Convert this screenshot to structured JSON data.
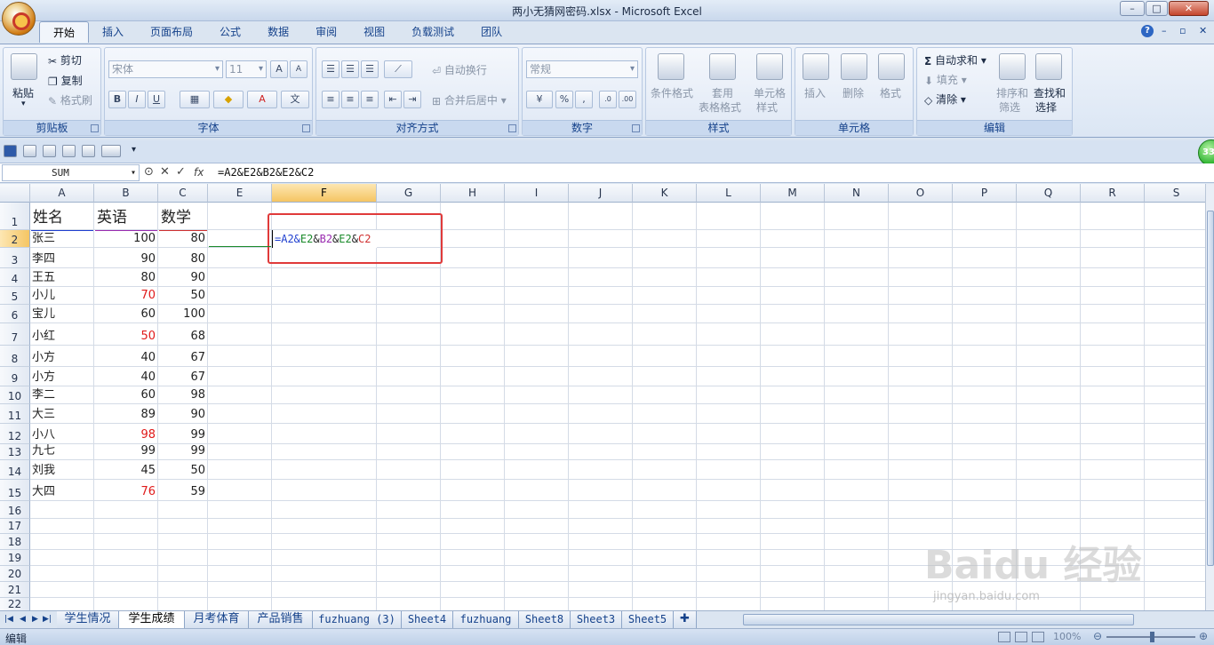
{
  "window": {
    "title": "两小无猜网密码.xlsx - Microsoft Excel",
    "min": "–",
    "max": "□",
    "close": "✕"
  },
  "tabs": [
    "开始",
    "插入",
    "页面布局",
    "公式",
    "数据",
    "审阅",
    "视图",
    "负载测试",
    "团队"
  ],
  "ribbon": {
    "clipboard": {
      "label": "剪贴板",
      "paste": "粘贴",
      "cut": "剪切",
      "copy": "复制",
      "format_painter": "格式刷"
    },
    "font": {
      "label": "字体",
      "font_name": "宋体",
      "font_size": "11",
      "bold": "B",
      "italic": "I",
      "underline": "U",
      "grow": "A",
      "shrink": "A"
    },
    "alignment": {
      "label": "对齐方式",
      "wrap": "自动换行",
      "merge": "合并后居中"
    },
    "number": {
      "label": "数字",
      "format": "常规",
      "percent": "%",
      "comma": ","
    },
    "styles": {
      "label": "样式",
      "conditional": "条件格式",
      "table_format_1": "套用",
      "table_format_2": "表格格式",
      "cell_style_1": "单元格",
      "cell_style_2": "样式"
    },
    "cells": {
      "label": "单元格",
      "insert": "插入",
      "delete": "删除",
      "format": "格式"
    },
    "editing": {
      "label": "编辑",
      "autosum": "自动求和",
      "fill": "填充",
      "clear": "清除",
      "sort_1": "排序和",
      "sort_2": "筛选",
      "find_1": "查找和",
      "find_2": "选择"
    }
  },
  "formula_bar": {
    "name_box": "SUM",
    "formula": "=A2&E2&B2&E2&C2",
    "fx": "fx"
  },
  "columns": [
    "A",
    "B",
    "C",
    "E",
    "F",
    "G",
    "H",
    "I",
    "J",
    "K",
    "L",
    "M",
    "N",
    "O",
    "P",
    "Q",
    "R",
    "S"
  ],
  "rows": [
    "1",
    "2",
    "3",
    "4",
    "5",
    "6",
    "7",
    "8",
    "9",
    "10",
    "11",
    "12",
    "13",
    "14",
    "15",
    "16",
    "17",
    "18",
    "19",
    "20",
    "21",
    "22"
  ],
  "headers": {
    "name": "姓名",
    "english": "英语",
    "math": "数学"
  },
  "students": [
    {
      "name": "张三",
      "english": "100",
      "math": "80",
      "red": false
    },
    {
      "name": "李四",
      "english": "90",
      "math": "80",
      "red": false
    },
    {
      "name": "王五",
      "english": "80",
      "math": "90",
      "red": false
    },
    {
      "name": "小儿",
      "english": "70",
      "math": "50",
      "red": true
    },
    {
      "name": "宝儿",
      "english": "60",
      "math": "100",
      "red": false
    },
    {
      "name": "小红",
      "english": "50",
      "math": "68",
      "red": true
    },
    {
      "name": "小方",
      "english": "40",
      "math": "67",
      "red": false
    },
    {
      "name": "小方",
      "english": "40",
      "math": "67",
      "red": false
    },
    {
      "name": "李二",
      "english": "60",
      "math": "98",
      "red": false
    },
    {
      "name": "大三",
      "english": "89",
      "math": "90",
      "red": false
    },
    {
      "name": "小八",
      "english": "98",
      "math": "99",
      "red": true
    },
    {
      "name": "九七",
      "english": "99",
      "math": "99",
      "red": false
    },
    {
      "name": "刘我",
      "english": "45",
      "math": "50",
      "red": false
    },
    {
      "name": "大四",
      "english": "76",
      "math": "59",
      "red": true
    }
  ],
  "edit_cell": {
    "p1": "=A2&",
    "p2": "E2",
    "p3": "&",
    "p4": "B2",
    "p5": "&",
    "p6": "E2",
    "p7": "&",
    "p8": "C2"
  },
  "sheets": [
    "学生情况",
    "学生成绩",
    "月考体育",
    "产品销售",
    "fuzhuang (3)",
    "Sheet4",
    "fuzhuang",
    "Sheet8",
    "Sheet3",
    "Sheet5"
  ],
  "active_sheet": "学生成绩",
  "status": {
    "mode": "编辑",
    "zoom": "100%"
  },
  "badge": "33",
  "watermark": {
    "brand": "Baidu 经验",
    "url": "jingyan.baidu.com"
  },
  "colors": {
    "ref_blue": "#1f3fcf",
    "ref_green": "#1a8a2a",
    "ref_purple": "#9a2bb0",
    "ref_red": "#d03030",
    "highlight_box": "#e03a3a"
  }
}
